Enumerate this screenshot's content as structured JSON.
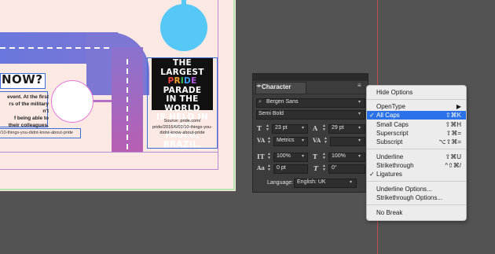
{
  "artboard": {
    "headline": {
      "line1": "THE LARGEST",
      "pride": [
        "P",
        "R",
        "I",
        "D",
        "E"
      ],
      "parade": " PARADE",
      "line3": "IN THE WORLD",
      "line4": "IS HELD IN SAO",
      "line5": "PAULO, BRAZIL."
    },
    "source": {
      "line1": "Source: pride.com/",
      "line2": "pride/2016/6/02/10-things-you-",
      "line3": "didnt-know-about-pride"
    },
    "now_heading": "NOW?",
    "body": {
      "line1": "event. At the first",
      "line2": "rs of the military",
      "line3": "n't",
      "line4": "f being able to",
      "line5": "their colleagues."
    },
    "url": "/10-things-you-didnt-know-about-pride"
  },
  "character_panel": {
    "title": "Character",
    "font_family": "Bergen Sans",
    "font_style": "Semi Bold",
    "font_size": "23 pt",
    "leading": "29 pt",
    "kerning": "Metrics",
    "tracking": "",
    "vertical_scale": "100%",
    "horizontal_scale": "100%",
    "baseline_shift": "0 pt",
    "skew": "0°",
    "language_label": "Language:",
    "language_value": "English: UK"
  },
  "menu": {
    "hide_options": "Hide Options",
    "opentype": "OpenType",
    "items": [
      {
        "label": "All Caps",
        "shortcut": "⇧⌘K",
        "checked": true,
        "highlighted": true
      },
      {
        "label": "Small Caps",
        "shortcut": "⇧⌘H",
        "checked": false
      },
      {
        "label": "Superscript",
        "shortcut": "⇧⌘=",
        "checked": false
      },
      {
        "label": "Subscript",
        "shortcut": "⌥⇧⌘=",
        "checked": false
      }
    ],
    "items2": [
      {
        "label": "Underline",
        "shortcut": "⇧⌘U",
        "checked": false
      },
      {
        "label": "Strikethrough",
        "shortcut": "^⇧⌘/",
        "checked": false
      },
      {
        "label": "Ligatures",
        "shortcut": "",
        "checked": true
      }
    ],
    "underline_options": "Underline Options...",
    "strikethrough_options": "Strikethrough Options...",
    "no_break": "No Break"
  },
  "colors": {
    "highlight": "#2b72e8",
    "workspace": "#535353",
    "panel": "#3c3c3c"
  }
}
